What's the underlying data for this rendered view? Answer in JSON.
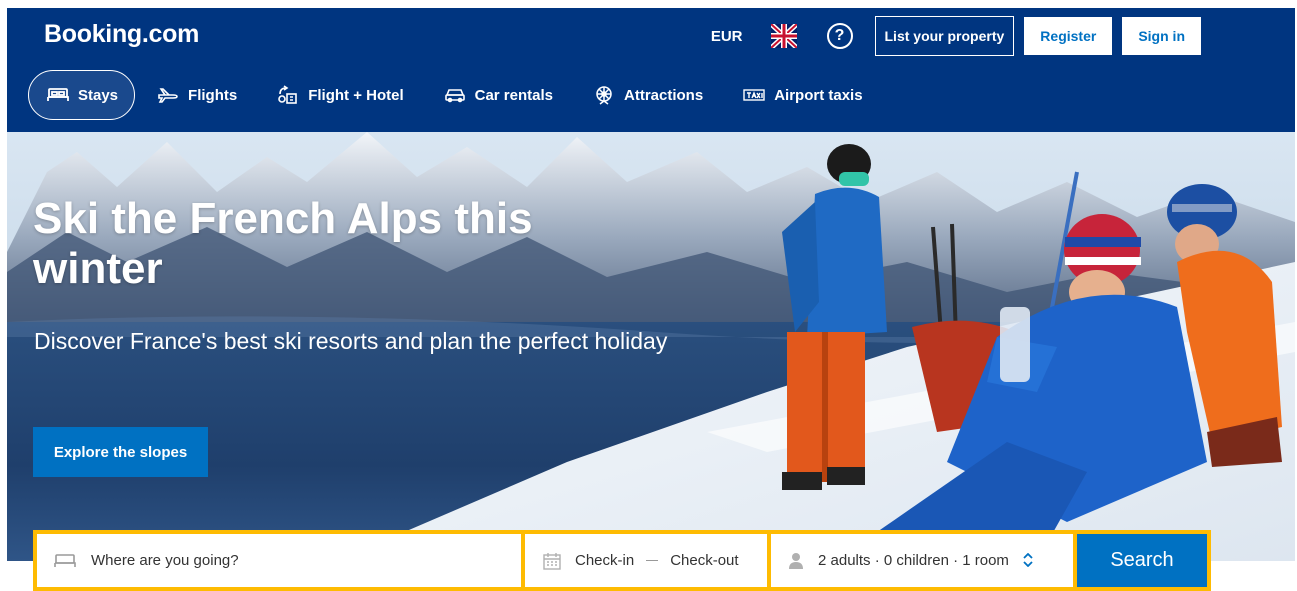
{
  "header": {
    "logo": "Booking.com",
    "currency": "EUR",
    "list_property": "List your property",
    "register": "Register",
    "sign_in": "Sign in"
  },
  "nav": {
    "items": [
      {
        "label": "Stays",
        "icon": "bed-icon",
        "active": true
      },
      {
        "label": "Flights",
        "icon": "plane-icon"
      },
      {
        "label": "Flight + Hotel",
        "icon": "plane-hotel-icon"
      },
      {
        "label": "Car rentals",
        "icon": "car-icon"
      },
      {
        "label": "Attractions",
        "icon": "attractions-icon"
      },
      {
        "label": "Airport taxis",
        "icon": "taxi-icon"
      }
    ]
  },
  "hero": {
    "title": "Ski the French Alps this winter",
    "subtitle": "Discover France's best ski resorts and plan the perfect holiday",
    "cta": "Explore the slopes"
  },
  "search": {
    "destination_placeholder": "Where are you going?",
    "check_in": "Check-in",
    "check_out": "Check-out",
    "guests": "2 adults · 0 children · 1 room",
    "button": "Search"
  },
  "colors": {
    "brand": "#003580",
    "accent": "#0071c2",
    "search_border": "#febb02"
  }
}
